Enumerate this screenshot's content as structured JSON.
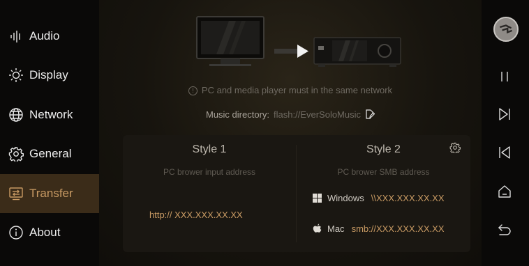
{
  "sidebar": {
    "items": [
      {
        "label": "Audio",
        "icon": "audio-bars-icon"
      },
      {
        "label": "Display",
        "icon": "brightness-icon"
      },
      {
        "label": "Network",
        "icon": "globe-icon"
      },
      {
        "label": "General",
        "icon": "gear-icon"
      },
      {
        "label": "Transfer",
        "icon": "transfer-icon",
        "active": true
      },
      {
        "label": "About",
        "icon": "info-icon"
      }
    ],
    "active_color": "#c89a63"
  },
  "main": {
    "note": "PC and media player must in the same network",
    "music_directory_label": "Music directory:",
    "music_directory_value": "flash://EverSoloMusic",
    "style1": {
      "title": "Style 1",
      "subtitle": "PC brower input address",
      "address": "http:// XXX.XXX.XX.XX"
    },
    "style2": {
      "title": "Style 2",
      "subtitle": "PC brower SMB address",
      "windows_label": "Windows",
      "windows_address": "\\\\XXX.XXX.XX.XX",
      "mac_label": "Mac",
      "mac_address": "smb://XXX.XXX.XX.XX"
    }
  },
  "rail": {
    "buttons": [
      "album-cover",
      "pause-icon",
      "next-track-icon",
      "previous-track-icon",
      "home-icon",
      "back-icon"
    ]
  }
}
